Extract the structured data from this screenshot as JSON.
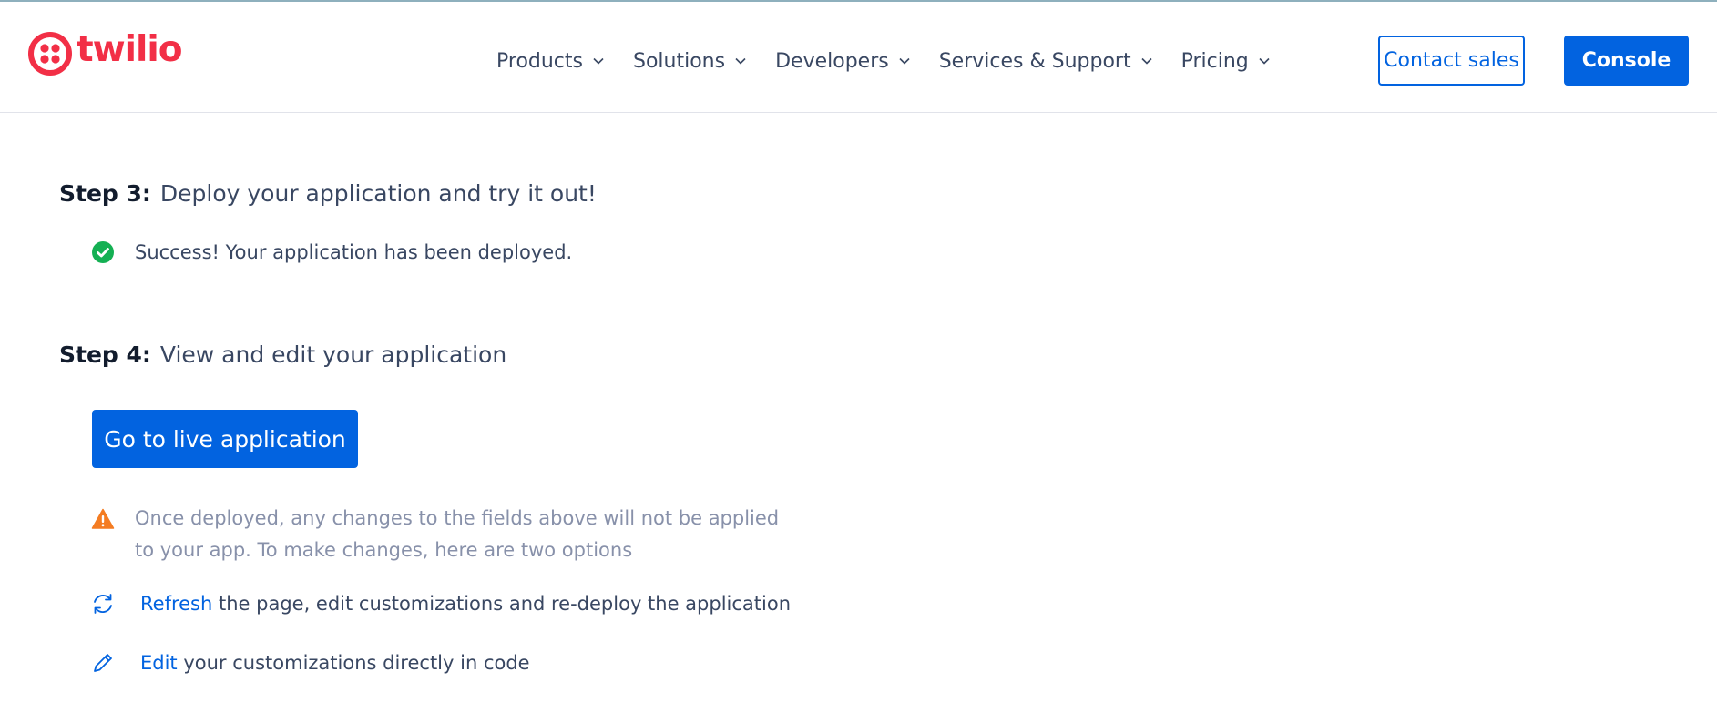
{
  "header": {
    "logo_text": "twilio",
    "brand_color": "#f22f46",
    "nav": [
      {
        "label": "Products"
      },
      {
        "label": "Solutions"
      },
      {
        "label": "Developers"
      },
      {
        "label": "Services & Support"
      },
      {
        "label": "Pricing"
      }
    ],
    "contact_sales_label": "Contact sales",
    "console_label": "Console",
    "accent_color": "#0263e0"
  },
  "step3": {
    "number": "Step 3:",
    "title": "Deploy your application and try it out!",
    "success_icon": "check-circle-icon",
    "success_text": "Success! Your application has been deployed."
  },
  "step4": {
    "number": "Step 4:",
    "title": "View and edit your application",
    "live_button_label": "Go to live application",
    "warning_icon": "warning-triangle-icon",
    "warning_text": "Once deployed, any changes to the fields above will not be applied to your app. To make changes, here are two options",
    "refresh_icon": "refresh-icon",
    "refresh_link": "Refresh",
    "refresh_rest": " the page, edit customizations and re-deploy the application",
    "edit_icon": "pencil-icon",
    "edit_link": "Edit",
    "edit_rest": " your customizations directly in code"
  }
}
